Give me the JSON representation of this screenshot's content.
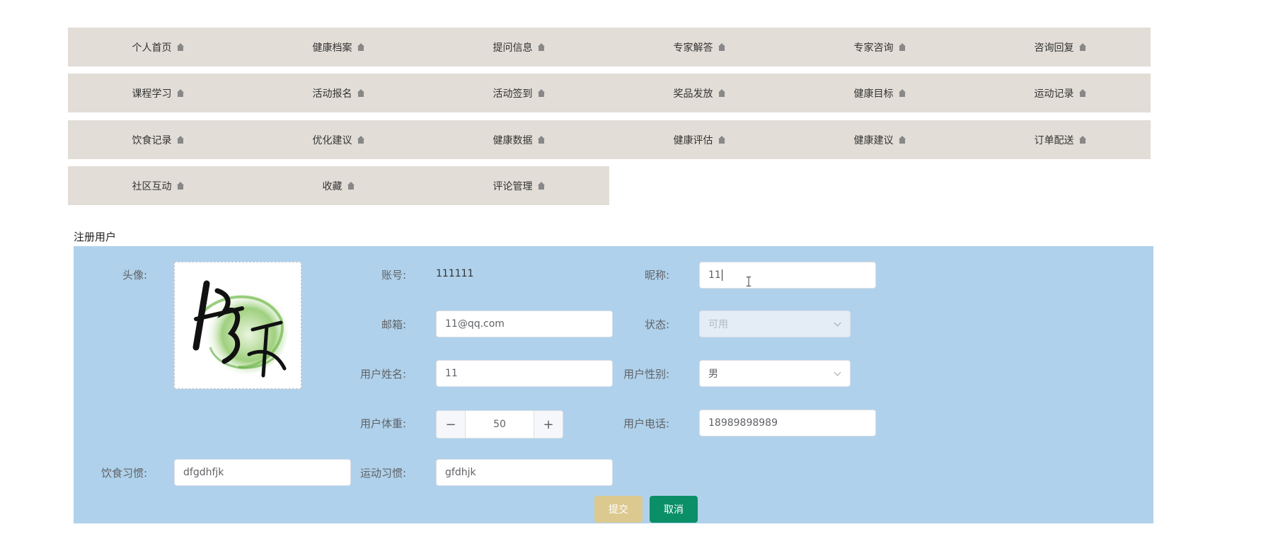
{
  "nav": {
    "row1": [
      "个人首页",
      "健康档案",
      "提问信息",
      "专家解答",
      "专家咨询",
      "咨询回复"
    ],
    "row2": [
      "课程学习",
      "活动报名",
      "活动签到",
      "奖品发放",
      "健康目标",
      "运动记录"
    ],
    "row3": [
      "饮食记录",
      "优化建议",
      "健康数据",
      "健康评估",
      "健康建议",
      "订单配送"
    ],
    "row4": [
      "社区互动",
      "收藏",
      "评论管理"
    ]
  },
  "form": {
    "title": "注册用户",
    "avatar_label": "头像:",
    "account_label": "账号:",
    "account_value": "111111",
    "nickname_label": "昵称:",
    "nickname_value": "11",
    "email_label": "邮箱:",
    "email_value": "11@qq.com",
    "status_label": "状态:",
    "status_value": "可用",
    "realname_label": "用户姓名:",
    "realname_value": "11",
    "gender_label": "用户性别:",
    "gender_value": "男",
    "weight_label": "用户体重:",
    "weight_value": "50",
    "phone_label": "用户电话:",
    "phone_value": "18989898989",
    "diet_label": "饮食习惯:",
    "diet_value": "dfgdhfjk",
    "exercise_label": "运动习惯:",
    "exercise_value": "gfdhjk",
    "submit_label": "提交",
    "cancel_label": "取消"
  },
  "colors": {
    "nav_bg": "#e2ddd6",
    "panel_bg": "#afd1eb",
    "submit_bg": "#dbc98f",
    "cancel_bg": "#0b8f67"
  }
}
